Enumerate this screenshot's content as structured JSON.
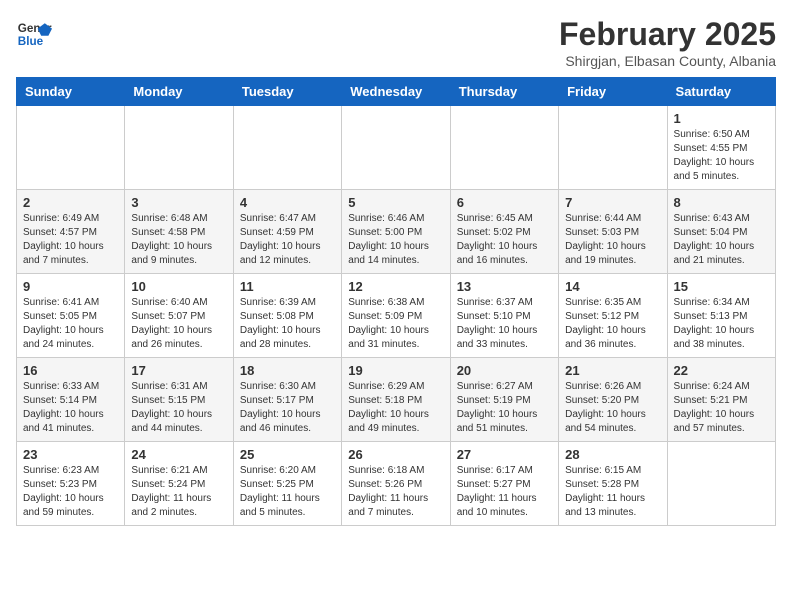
{
  "header": {
    "logo_general": "General",
    "logo_blue": "Blue",
    "month": "February 2025",
    "location": "Shirgjan, Elbasan County, Albania"
  },
  "weekdays": [
    "Sunday",
    "Monday",
    "Tuesday",
    "Wednesday",
    "Thursday",
    "Friday",
    "Saturday"
  ],
  "weeks": [
    [
      {
        "day": "",
        "info": ""
      },
      {
        "day": "",
        "info": ""
      },
      {
        "day": "",
        "info": ""
      },
      {
        "day": "",
        "info": ""
      },
      {
        "day": "",
        "info": ""
      },
      {
        "day": "",
        "info": ""
      },
      {
        "day": "1",
        "info": "Sunrise: 6:50 AM\nSunset: 4:55 PM\nDaylight: 10 hours and 5 minutes."
      }
    ],
    [
      {
        "day": "2",
        "info": "Sunrise: 6:49 AM\nSunset: 4:57 PM\nDaylight: 10 hours and 7 minutes."
      },
      {
        "day": "3",
        "info": "Sunrise: 6:48 AM\nSunset: 4:58 PM\nDaylight: 10 hours and 9 minutes."
      },
      {
        "day": "4",
        "info": "Sunrise: 6:47 AM\nSunset: 4:59 PM\nDaylight: 10 hours and 12 minutes."
      },
      {
        "day": "5",
        "info": "Sunrise: 6:46 AM\nSunset: 5:00 PM\nDaylight: 10 hours and 14 minutes."
      },
      {
        "day": "6",
        "info": "Sunrise: 6:45 AM\nSunset: 5:02 PM\nDaylight: 10 hours and 16 minutes."
      },
      {
        "day": "7",
        "info": "Sunrise: 6:44 AM\nSunset: 5:03 PM\nDaylight: 10 hours and 19 minutes."
      },
      {
        "day": "8",
        "info": "Sunrise: 6:43 AM\nSunset: 5:04 PM\nDaylight: 10 hours and 21 minutes."
      }
    ],
    [
      {
        "day": "9",
        "info": "Sunrise: 6:41 AM\nSunset: 5:05 PM\nDaylight: 10 hours and 24 minutes."
      },
      {
        "day": "10",
        "info": "Sunrise: 6:40 AM\nSunset: 5:07 PM\nDaylight: 10 hours and 26 minutes."
      },
      {
        "day": "11",
        "info": "Sunrise: 6:39 AM\nSunset: 5:08 PM\nDaylight: 10 hours and 28 minutes."
      },
      {
        "day": "12",
        "info": "Sunrise: 6:38 AM\nSunset: 5:09 PM\nDaylight: 10 hours and 31 minutes."
      },
      {
        "day": "13",
        "info": "Sunrise: 6:37 AM\nSunset: 5:10 PM\nDaylight: 10 hours and 33 minutes."
      },
      {
        "day": "14",
        "info": "Sunrise: 6:35 AM\nSunset: 5:12 PM\nDaylight: 10 hours and 36 minutes."
      },
      {
        "day": "15",
        "info": "Sunrise: 6:34 AM\nSunset: 5:13 PM\nDaylight: 10 hours and 38 minutes."
      }
    ],
    [
      {
        "day": "16",
        "info": "Sunrise: 6:33 AM\nSunset: 5:14 PM\nDaylight: 10 hours and 41 minutes."
      },
      {
        "day": "17",
        "info": "Sunrise: 6:31 AM\nSunset: 5:15 PM\nDaylight: 10 hours and 44 minutes."
      },
      {
        "day": "18",
        "info": "Sunrise: 6:30 AM\nSunset: 5:17 PM\nDaylight: 10 hours and 46 minutes."
      },
      {
        "day": "19",
        "info": "Sunrise: 6:29 AM\nSunset: 5:18 PM\nDaylight: 10 hours and 49 minutes."
      },
      {
        "day": "20",
        "info": "Sunrise: 6:27 AM\nSunset: 5:19 PM\nDaylight: 10 hours and 51 minutes."
      },
      {
        "day": "21",
        "info": "Sunrise: 6:26 AM\nSunset: 5:20 PM\nDaylight: 10 hours and 54 minutes."
      },
      {
        "day": "22",
        "info": "Sunrise: 6:24 AM\nSunset: 5:21 PM\nDaylight: 10 hours and 57 minutes."
      }
    ],
    [
      {
        "day": "23",
        "info": "Sunrise: 6:23 AM\nSunset: 5:23 PM\nDaylight: 10 hours and 59 minutes."
      },
      {
        "day": "24",
        "info": "Sunrise: 6:21 AM\nSunset: 5:24 PM\nDaylight: 11 hours and 2 minutes."
      },
      {
        "day": "25",
        "info": "Sunrise: 6:20 AM\nSunset: 5:25 PM\nDaylight: 11 hours and 5 minutes."
      },
      {
        "day": "26",
        "info": "Sunrise: 6:18 AM\nSunset: 5:26 PM\nDaylight: 11 hours and 7 minutes."
      },
      {
        "day": "27",
        "info": "Sunrise: 6:17 AM\nSunset: 5:27 PM\nDaylight: 11 hours and 10 minutes."
      },
      {
        "day": "28",
        "info": "Sunrise: 6:15 AM\nSunset: 5:28 PM\nDaylight: 11 hours and 13 minutes."
      },
      {
        "day": "",
        "info": ""
      }
    ]
  ]
}
